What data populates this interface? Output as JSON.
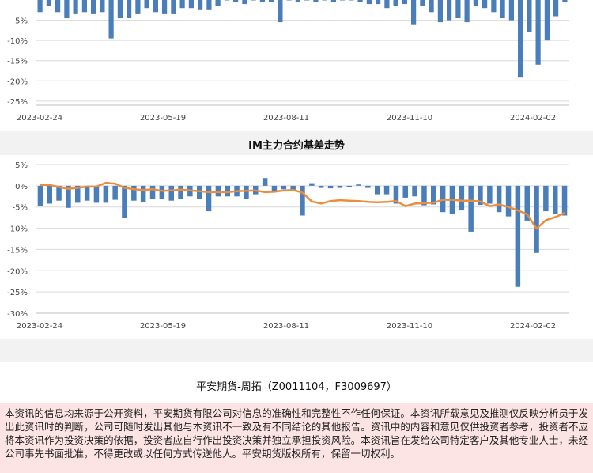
{
  "header": {
    "title": "IM主力合约基差走势"
  },
  "footer": {
    "signature": "平安期货-周拓（Z0011104，F3009697）",
    "disclaimer": "本资讯的信息均来源于公开资料，平安期货有限公司对信息的准确性和完整性不作任何保证。本资讯所载意见及推测仅反映分析员于发出此资讯时的判断，公司可随时发出其他与本资讯不一致及有不同结论的其他报告。资讯中的内容和意见仅供投资者参考，投资者不应将本资讯作为投资决策的依据，投资者应自行作出投资决策并独立承担投资风险。本资讯旨在发给公司特定客户及其他专业人士，未经公司事先书面批准，不得更改或以任何方式传送他人。平安期货版权所有，保留一切权利。"
  },
  "colors": {
    "bar": "#4a7ebb",
    "line": "#ed8c3a",
    "grid": "#d9d9d9",
    "panel_bg": "#f2f2f2"
  },
  "chart_data": [
    {
      "type": "bar",
      "title": "",
      "x_tick_labels": [
        "2023-02-24",
        "2023-05-19",
        "2023-08-11",
        "2023-11-10",
        "2024-02-02"
      ],
      "y_tick_labels": [
        "-5%",
        "-10%",
        "-15%",
        "-20%",
        "-25%"
      ],
      "ylim": [
        -26,
        0
      ],
      "grid": true,
      "series": [
        {
          "values": [
            -3,
            -1.5,
            -3,
            -4.5,
            -3.5,
            -3,
            -3.5,
            -3,
            -9.5,
            -4.5,
            -4.5,
            -3.5,
            -2,
            -3,
            -3.5,
            -3.5,
            -2,
            -2,
            -2.5,
            -2.5,
            -1.5,
            0,
            -0.5,
            -1,
            0,
            -0.5,
            -0.5,
            -5.5,
            0,
            -0.5,
            0,
            -0.5,
            0,
            -0.5,
            0,
            0,
            -0.5,
            -1,
            -1,
            -2,
            -1.5,
            -1,
            -6,
            -1.5,
            -3,
            -5.5,
            -5,
            -4.5,
            -5.5,
            -1.5,
            -2,
            -3,
            -4.5,
            -5,
            -19,
            -8,
            -16,
            -10,
            -4,
            -0.5
          ]
        }
      ]
    },
    {
      "type": "bar",
      "title": "IM主力合约基差走势",
      "x_tick_labels": [
        "2023-02-24",
        "2023-05-19",
        "2023-08-11",
        "2023-11-10",
        "2024-02-02"
      ],
      "y_tick_labels": [
        "5%",
        "0%",
        "-5%",
        "-10%",
        "-15%",
        "-20%",
        "-25%",
        "-30%"
      ],
      "ylim": [
        -30,
        5
      ],
      "grid": true,
      "series": [
        {
          "type": "bar",
          "values": [
            -4.8,
            -4.2,
            -3.5,
            -5.2,
            -4,
            -3.5,
            -4,
            -4,
            -3.3,
            -7.5,
            -3.5,
            -3.8,
            -3,
            -3,
            -3.5,
            -3,
            -2.5,
            -3,
            -6,
            -2.5,
            -2.5,
            -2.5,
            -3,
            -2,
            1.8,
            -1.2,
            -0.8,
            -1,
            -7,
            0.6,
            -0.5,
            -0.6,
            -0.5,
            -0.3,
            0.3,
            -0.5,
            -2,
            -2,
            -4.2,
            -2.8,
            -2.5,
            -4.6,
            -4.4,
            -6.2,
            -6.6,
            -5.8,
            -10.8,
            -4.5,
            -4.2,
            -6.2,
            -7.2,
            -23.8,
            -8.2,
            -15.8,
            -6,
            -6.6,
            -7
          ]
        },
        {
          "type": "line",
          "values": [
            0.2,
            0.2,
            -0.3,
            -0.7,
            -0.5,
            -0.2,
            -0.2,
            0.7,
            0.5,
            -0.5,
            -0.8,
            -1,
            -0.8,
            -1.2,
            -1.1,
            -0.9,
            -1.1,
            -1.3,
            -1.5,
            -1.5,
            -1.5,
            -1.3,
            -1.2,
            -1.1,
            -1.5,
            -1.4,
            -1.1,
            -1,
            -1.6,
            -3.7,
            -4.2,
            -3.6,
            -3.4,
            -3.5,
            -3.6,
            -3.8,
            -3.9,
            -3.8,
            -3.6,
            -4.8,
            -4.2,
            -4.1,
            -4,
            -3.3,
            -3.3,
            -3.5,
            -3.5,
            -3.7,
            -4.8,
            -4.4,
            -5,
            -5.8,
            -6.7,
            -10.1,
            -8.1,
            -7.4,
            -6.4
          ]
        }
      ]
    }
  ]
}
